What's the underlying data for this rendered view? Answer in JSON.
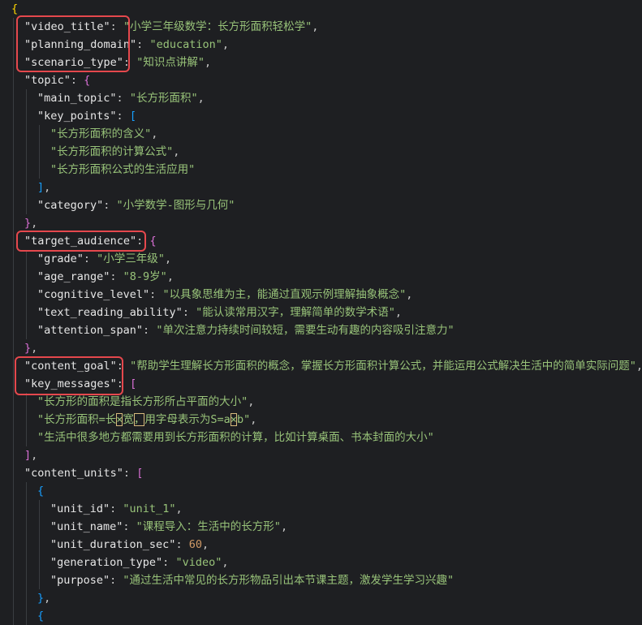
{
  "editor": {
    "theme_colors": {
      "background": "#1e1f22",
      "key": "#e6e6e6",
      "string": "#98c379",
      "number": "#d19a66",
      "highlight": "#e5484d"
    },
    "lines": [
      [
        {
          "t": "{",
          "c": "b1"
        }
      ],
      [
        {
          "t": "\"video_title\"",
          "c": "k"
        },
        {
          "t": ": ",
          "c": "p"
        },
        {
          "t": "\"小学三年级数学：长方形面积轻松学\"",
          "c": "s"
        },
        {
          "t": ",",
          "c": "p"
        }
      ],
      [
        {
          "t": "\"planning_domain\"",
          "c": "k"
        },
        {
          "t": ": ",
          "c": "p"
        },
        {
          "t": "\"education\"",
          "c": "s"
        },
        {
          "t": ",",
          "c": "p"
        }
      ],
      [
        {
          "t": "\"scenario_type\"",
          "c": "k"
        },
        {
          "t": ": ",
          "c": "p"
        },
        {
          "t": "\"知识点讲解\"",
          "c": "s"
        },
        {
          "t": ",",
          "c": "p"
        }
      ],
      [
        {
          "t": "\"topic\"",
          "c": "k"
        },
        {
          "t": ": ",
          "c": "p"
        },
        {
          "t": "{",
          "c": "b2"
        }
      ],
      [
        {
          "t": "\"main_topic\"",
          "c": "k"
        },
        {
          "t": ": ",
          "c": "p"
        },
        {
          "t": "\"长方形面积\"",
          "c": "s"
        },
        {
          "t": ",",
          "c": "p"
        }
      ],
      [
        {
          "t": "\"key_points\"",
          "c": "k"
        },
        {
          "t": ": ",
          "c": "p"
        },
        {
          "t": "[",
          "c": "b3"
        }
      ],
      [
        {
          "t": "\"长方形面积的含义\"",
          "c": "s"
        },
        {
          "t": ",",
          "c": "p"
        }
      ],
      [
        {
          "t": "\"长方形面积的计算公式\"",
          "c": "s"
        },
        {
          "t": ",",
          "c": "p"
        }
      ],
      [
        {
          "t": "\"长方形面积公式的生活应用\"",
          "c": "s"
        }
      ],
      [
        {
          "t": "]",
          "c": "b3"
        },
        {
          "t": ",",
          "c": "p"
        }
      ],
      [
        {
          "t": "\"category\"",
          "c": "k"
        },
        {
          "t": ": ",
          "c": "p"
        },
        {
          "t": "\"小学数学-图形与几何\"",
          "c": "s"
        }
      ],
      [
        {
          "t": "}",
          "c": "b2"
        },
        {
          "t": ",",
          "c": "p"
        }
      ],
      [
        {
          "t": "\"target_audience\"",
          "c": "k"
        },
        {
          "t": ": ",
          "c": "p"
        },
        {
          "t": "{",
          "c": "b2"
        }
      ],
      [
        {
          "t": "\"grade\"",
          "c": "k"
        },
        {
          "t": ": ",
          "c": "p"
        },
        {
          "t": "\"小学三年级\"",
          "c": "s"
        },
        {
          "t": ",",
          "c": "p"
        }
      ],
      [
        {
          "t": "\"age_range\"",
          "c": "k"
        },
        {
          "t": ": ",
          "c": "p"
        },
        {
          "t": "\"8-9岁\"",
          "c": "s"
        },
        {
          "t": ",",
          "c": "p"
        }
      ],
      [
        {
          "t": "\"cognitive_level\"",
          "c": "k"
        },
        {
          "t": ": ",
          "c": "p"
        },
        {
          "t": "\"以具象思维为主，能通过直观示例理解抽象概念\"",
          "c": "s"
        },
        {
          "t": ",",
          "c": "p"
        }
      ],
      [
        {
          "t": "\"text_reading_ability\"",
          "c": "k"
        },
        {
          "t": ": ",
          "c": "p"
        },
        {
          "t": "\"能认读常用汉字，理解简单的数学术语\"",
          "c": "s"
        },
        {
          "t": ",",
          "c": "p"
        }
      ],
      [
        {
          "t": "\"attention_span\"",
          "c": "k"
        },
        {
          "t": ": ",
          "c": "p"
        },
        {
          "t": "\"单次注意力持续时间较短，需要生动有趣的内容吸引注意力\"",
          "c": "s"
        }
      ],
      [
        {
          "t": "}",
          "c": "b2"
        },
        {
          "t": ",",
          "c": "p"
        }
      ],
      [
        {
          "t": "\"content_goal\"",
          "c": "k"
        },
        {
          "t": ": ",
          "c": "p"
        },
        {
          "t": "\"帮助学生理解长方形面积的概念，掌握长方形面积计算公式，并能运用公式解决生活中的简单实际问题\"",
          "c": "s"
        },
        {
          "t": ",",
          "c": "p"
        }
      ],
      [
        {
          "t": "\"key_messages\"",
          "c": "k"
        },
        {
          "t": ": ",
          "c": "p"
        },
        {
          "t": "[",
          "c": "b2"
        }
      ],
      [
        {
          "t": "\"长方形的面积是指长方形所占平面的大小\"",
          "c": "s"
        },
        {
          "t": ",",
          "c": "p"
        }
      ],
      [
        {
          "t": "\"长方形面积=长",
          "c": "s"
        },
        {
          "t": "×",
          "c": "s",
          "m": 1
        },
        {
          "t": "宽",
          "c": "s"
        },
        {
          "t": "，",
          "c": "s",
          "m": 1
        },
        {
          "t": "用字母表示为S=a",
          "c": "s"
        },
        {
          "t": "×",
          "c": "s",
          "m": 1
        },
        {
          "t": "b\"",
          "c": "s"
        },
        {
          "t": ",",
          "c": "p"
        }
      ],
      [
        {
          "t": "\"生活中很多地方都需要用到长方形面积的计算，比如计算桌面、书本封面的大小\"",
          "c": "s"
        }
      ],
      [
        {
          "t": "]",
          "c": "b2"
        },
        {
          "t": ",",
          "c": "p"
        }
      ],
      [
        {
          "t": "\"content_units\"",
          "c": "k"
        },
        {
          "t": ": ",
          "c": "p"
        },
        {
          "t": "[",
          "c": "b2"
        }
      ],
      [
        {
          "t": "{",
          "c": "b3"
        }
      ],
      [
        {
          "t": "\"unit_id\"",
          "c": "k"
        },
        {
          "t": ": ",
          "c": "p"
        },
        {
          "t": "\"unit_1\"",
          "c": "s"
        },
        {
          "t": ",",
          "c": "p"
        }
      ],
      [
        {
          "t": "\"unit_name\"",
          "c": "k"
        },
        {
          "t": ": ",
          "c": "p"
        },
        {
          "t": "\"课程导入：生活中的长方形\"",
          "c": "s"
        },
        {
          "t": ",",
          "c": "p"
        }
      ],
      [
        {
          "t": "\"unit_duration_sec\"",
          "c": "k"
        },
        {
          "t": ": ",
          "c": "p"
        },
        {
          "t": "60",
          "c": "n"
        },
        {
          "t": ",",
          "c": "p"
        }
      ],
      [
        {
          "t": "\"generation_type\"",
          "c": "k"
        },
        {
          "t": ": ",
          "c": "p"
        },
        {
          "t": "\"video\"",
          "c": "s"
        },
        {
          "t": ",",
          "c": "p"
        }
      ],
      [
        {
          "t": "\"purpose\"",
          "c": "k"
        },
        {
          "t": ": ",
          "c": "p"
        },
        {
          "t": "\"通过生活中常见的长方形物品引出本节课主题，激发学生学习兴趣\"",
          "c": "s"
        }
      ],
      [
        {
          "t": "}",
          "c": "b3"
        },
        {
          "t": ",",
          "c": "p"
        }
      ],
      [
        {
          "t": "{",
          "c": "b3"
        }
      ]
    ]
  }
}
